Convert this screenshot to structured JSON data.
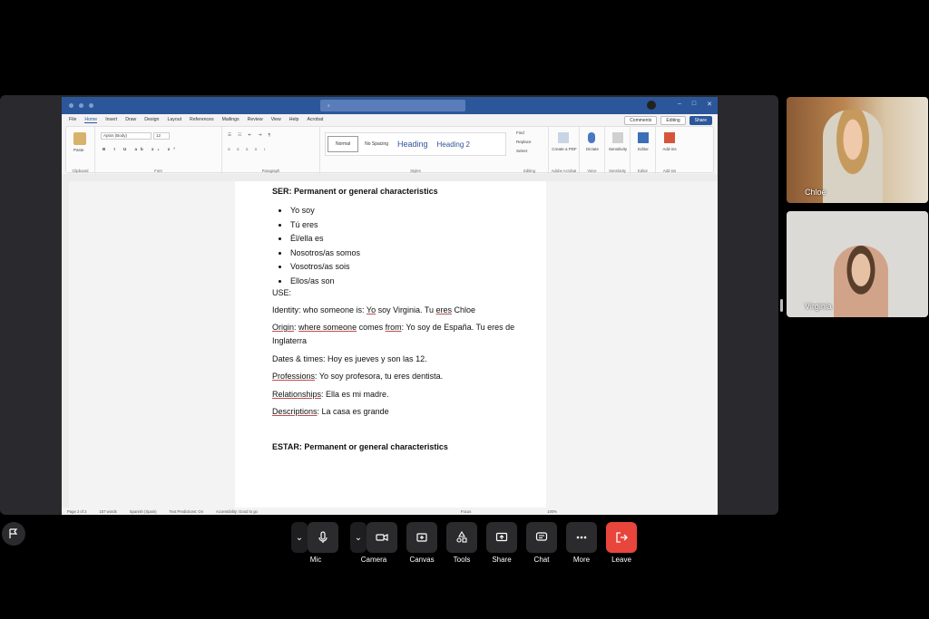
{
  "word": {
    "menu": [
      "File",
      "Home",
      "Insert",
      "Draw",
      "Design",
      "Layout",
      "References",
      "Mailings",
      "Review",
      "View",
      "Help",
      "Acrobat"
    ],
    "active_menu": "Home",
    "buttons": {
      "comments": "Comments",
      "editing": "Editing",
      "share": "Share"
    },
    "ribbon": {
      "font_name": "Aptos (Body)",
      "font_size": "12",
      "groups": [
        "Clipboard",
        "Font",
        "Paragraph",
        "Styles",
        "Editing",
        "Adobe Acrobat",
        "Voice",
        "Sensitivity",
        "Editor",
        "Add-ins"
      ],
      "styles": [
        "Normal",
        "No Spacing",
        "Heading",
        "Heading 2"
      ],
      "editing_items": [
        "Find",
        "Replace",
        "Select"
      ],
      "right_buttons": [
        "Create a PDF",
        "Dictate",
        "Sensitivity",
        "Editor",
        "Add-ins"
      ],
      "paste": "Paste"
    },
    "status": {
      "page": "Page 2 of 2",
      "words": "157 words",
      "lang": "Spanish (Spain)",
      "predictions": "Text Predictions: On",
      "accessibility": "Accessibility: Good to go",
      "focus": "Focus",
      "zoom": "100%"
    }
  },
  "doc": {
    "ser_heading": "SER: Permanent or general characteristics",
    "ser_items": [
      "Yo soy",
      "Tú eres",
      "Él/ella es",
      "Nosotros/as somos",
      "Vosotros/as sois",
      "Ellos/as son"
    ],
    "use": "USE:",
    "identity": {
      "a": "Identity: who someone is: ",
      "b": "Yo",
      "c": " soy Virginia. Tu ",
      "d": "eres",
      "e": " Chloe"
    },
    "origin": {
      "a": "Origin",
      "b": ": ",
      "c": "where someone",
      "d": " comes ",
      "e": "from",
      "f": ": Yo soy de España. Tu eres de Inglaterra"
    },
    "dates": "Dates & times: Hoy es jueves y son las 12.",
    "professions": {
      "a": "Professions",
      "b": ": Yo soy profesora, tu eres dentista."
    },
    "relationships": {
      "a": "Relationships",
      "b": ": Ella es mi madre."
    },
    "descriptions": {
      "a": "Descriptions",
      "b": ": La casa es grande"
    },
    "estar_heading": "ESTAR: Permanent or general characteristics"
  },
  "participants": [
    {
      "name": "Chloe"
    },
    {
      "name": "Virginia"
    }
  ],
  "controls": [
    {
      "label": "Mic",
      "icon": "mic-icon"
    },
    {
      "label": "Camera",
      "icon": "camera-icon"
    },
    {
      "label": "Canvas",
      "icon": "canvas-icon"
    },
    {
      "label": "Tools",
      "icon": "tools-icon"
    },
    {
      "label": "Share",
      "icon": "share-screen-icon"
    },
    {
      "label": "Chat",
      "icon": "chat-icon"
    },
    {
      "label": "More",
      "icon": "more-icon"
    },
    {
      "label": "Leave",
      "icon": "leave-icon"
    }
  ],
  "colors": {
    "word_blue": "#2b579a",
    "leave_red": "#e8453c",
    "control_bg": "#2b2b2e"
  }
}
